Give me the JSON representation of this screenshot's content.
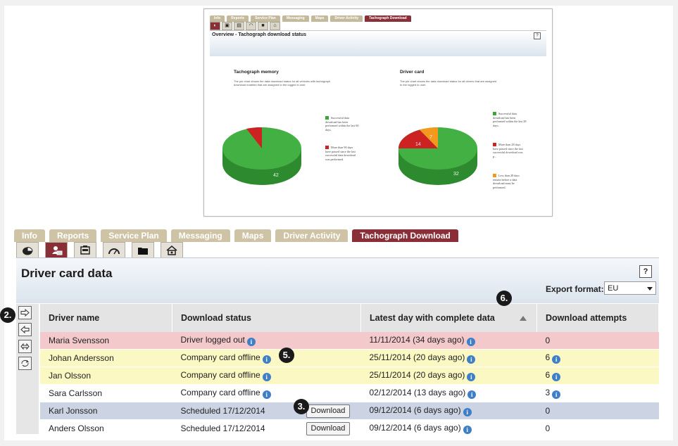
{
  "thumbnail": {
    "tabs": [
      "Info",
      "Reports",
      "Service Plan",
      "Messaging",
      "Maps",
      "Driver Activity",
      "Tachograph Download"
    ],
    "active_tab": "Tachograph Download",
    "title": "Overview - Tachograph download status",
    "help": "?",
    "memory": {
      "heading": "Tachograph memory",
      "description": "The pie chart shows the data download status for all vehicles with tachograph download enabled that are assigned to the logged in user.",
      "legend": [
        {
          "label": "Successful data download has been performed within the last 60 days.",
          "color": "#3aa63a"
        },
        {
          "label": "More than 90 days have passed since the last successful data download was performed.",
          "color": "#cc2222"
        }
      ],
      "slice_label": "42"
    },
    "card": {
      "heading": "Driver card",
      "description": "The pie chart shows the data download status for all drivers that are assigned to the logged in user.",
      "legend": [
        {
          "label": "Successful data download has been performed within the last 28 days.",
          "color": "#3aa63a"
        },
        {
          "label": "More than 28 days have passed since the last successful download was p...",
          "color": "#cc2222"
        },
        {
          "label": "Less than 28 days remain before a data download must be performed.",
          "color": "#f39a1e"
        }
      ],
      "slice_labels": [
        "32",
        "14",
        "7"
      ]
    }
  },
  "chart_data": [
    {
      "type": "pie",
      "title": "Tachograph memory",
      "categories": [
        "Downloaded within last 60 days",
        "More than 90 days since last download"
      ],
      "values": [
        42,
        5
      ]
    },
    {
      "type": "pie",
      "title": "Driver card",
      "categories": [
        "Downloaded within last 28 days",
        "More than 28 days since last download",
        "Less than 28 days remain"
      ],
      "values": [
        32,
        14,
        7
      ]
    }
  ],
  "tabs": [
    {
      "label": "Info",
      "active": false
    },
    {
      "label": "Reports",
      "active": false
    },
    {
      "label": "Service Plan",
      "active": false
    },
    {
      "label": "Messaging",
      "active": false
    },
    {
      "label": "Maps",
      "active": false
    },
    {
      "label": "Driver Activity",
      "active": false
    },
    {
      "label": "Tachograph Download",
      "active": true
    }
  ],
  "icon_toolbar": [
    "pie-chart-icon",
    "driver-card-icon",
    "tachograph-icon",
    "speedometer-icon",
    "folder-icon",
    "home-settings-icon"
  ],
  "page": {
    "title": "Driver card data",
    "help": "?",
    "export_label": "Export format:",
    "export_value": "EU"
  },
  "side_actions": [
    "arrow-right-icon",
    "arrow-left-icon",
    "swap-icon",
    "refresh-icon"
  ],
  "table": {
    "columns": [
      "Driver name",
      "Download status",
      "Latest day with complete data",
      "Download attempts"
    ],
    "rows": [
      {
        "name": "Maria Svensson",
        "status": "Driver logged out",
        "latest": "11/11/2014 (34 days ago)",
        "attempts": "0",
        "style": "red"
      },
      {
        "name": "Johan Andersson",
        "status": "Company card offline",
        "latest": "25/11/2014 (20 days ago)",
        "attempts": "6",
        "style": "yellow"
      },
      {
        "name": "Jan Olsson",
        "status": "Company card offline",
        "latest": "25/11/2014 (20 days ago)",
        "attempts": "6",
        "style": "yellow"
      },
      {
        "name": "Sara Carlsson",
        "status": "Company card offline",
        "latest": "02/12/2014 (13 days ago)",
        "attempts": "3",
        "style": "white"
      },
      {
        "name": "Karl Jonsson",
        "status": "Scheduled 17/12/2014",
        "latest": "09/12/2014 (6 days ago)",
        "attempts": "0",
        "style": "blue",
        "button": "Download"
      },
      {
        "name": "Anders Olsson",
        "status": "Scheduled 17/12/2014",
        "latest": "09/12/2014 (6 days ago)",
        "attempts": "0",
        "style": "white2",
        "button": "Download"
      }
    ]
  },
  "callouts": [
    "2.",
    "3.",
    "5.",
    "6."
  ]
}
